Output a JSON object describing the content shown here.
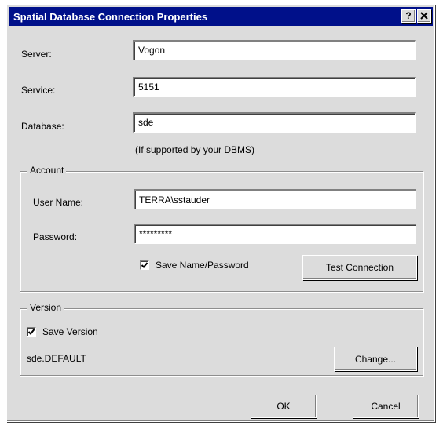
{
  "window": {
    "title": "Spatial Database Connection Properties",
    "help_button": "?",
    "close_button": "✕"
  },
  "connection": {
    "server_label": "Server:",
    "server_value": "Vogon",
    "service_label": "Service:",
    "service_value": "5151",
    "database_label": "Database:",
    "database_value": "sde",
    "database_hint": "(If supported by your DBMS)"
  },
  "account": {
    "group_label": "Account",
    "username_label": "User Name:",
    "username_value": "TERRA\\sstauder",
    "password_label": "Password:",
    "password_value": "*********",
    "save_label": "Save Name/Password",
    "save_checked": true,
    "test_button": "Test Connection"
  },
  "version": {
    "group_label": "Version",
    "save_label": "Save Version",
    "save_checked": true,
    "current_version": "sde.DEFAULT",
    "change_button": "Change..."
  },
  "footer": {
    "ok_button": "OK",
    "cancel_button": "Cancel"
  }
}
